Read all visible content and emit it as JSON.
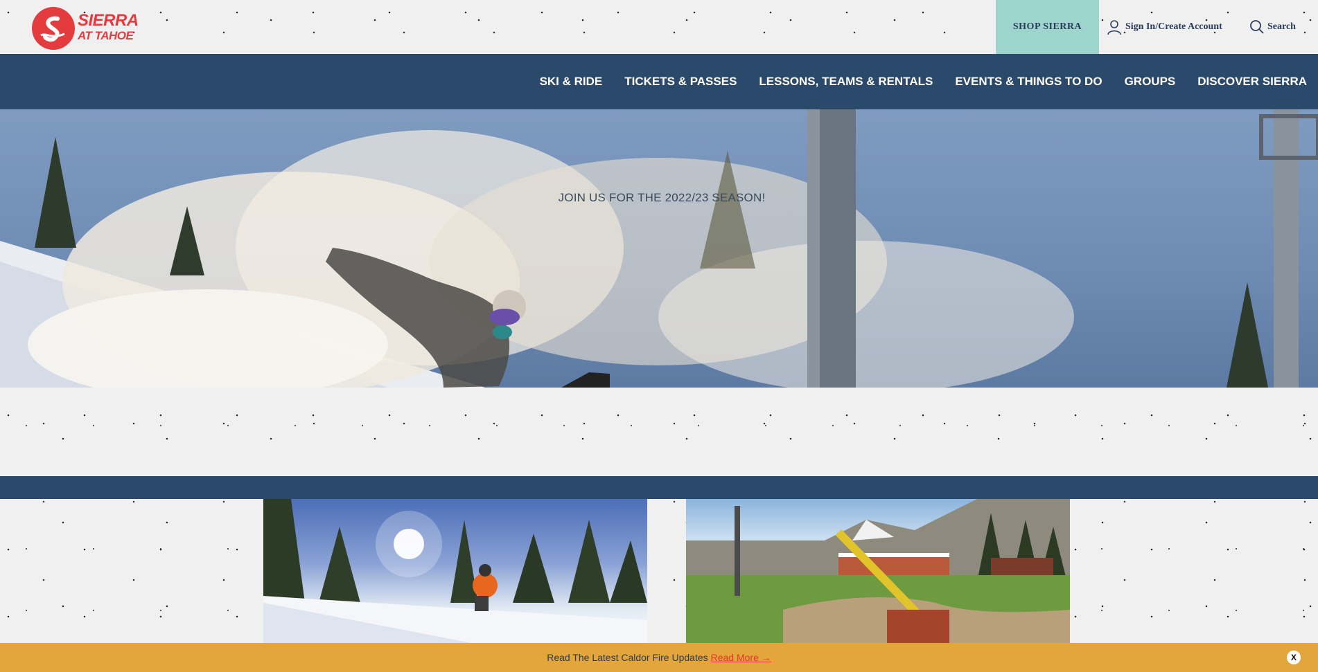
{
  "brand": {
    "line1": "SIERRA",
    "line2": "AT TAHOE"
  },
  "topbar": {
    "shop_label": "SHOP SIERRA",
    "signin_label": "Sign In/Create Account",
    "search_label": "Search"
  },
  "nav": {
    "items": [
      {
        "label": "SKI & RIDE"
      },
      {
        "label": "TICKETS & PASSES"
      },
      {
        "label": "LESSONS, TEAMS & RENTALS"
      },
      {
        "label": "EVENTS & THINGS TO DO"
      },
      {
        "label": "GROUPS"
      },
      {
        "label": "DISCOVER SIERRA"
      }
    ]
  },
  "hero": {
    "text": "JOIN US FOR THE 2022/23 SEASON!"
  },
  "alert": {
    "text": "Read The Latest Caldor Fire Updates",
    "link_label": "Read More →",
    "close_label": "X"
  },
  "colors": {
    "brand_red": "#e43b3f",
    "navy": "#2b4a6b",
    "teal": "#9dd5cd",
    "alert_yellow": "#e3a63a"
  },
  "icons": [
    "logo-icon",
    "user-icon",
    "search-icon",
    "close-icon"
  ]
}
